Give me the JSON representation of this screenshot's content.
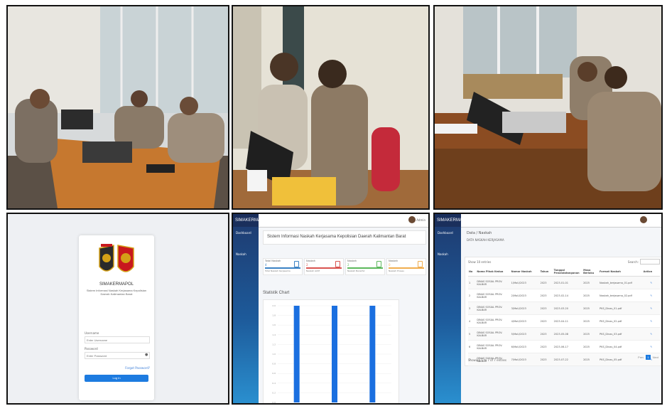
{
  "photos": [
    {
      "label": "meeting-photo-1"
    },
    {
      "label": "meeting-photo-2"
    },
    {
      "label": "meeting-photo-3"
    }
  ],
  "login": {
    "app_name": "SIMAKERMAPOL",
    "subtitle": "Sistem Informasi Naskah Kerjasama Kepolisian Daerah Kalimantan Barat",
    "username_label": "Username",
    "username_placeholder": "Enter Username",
    "password_label": "Password",
    "password_placeholder": "Enter Password",
    "forgot": "Forgot Password?",
    "login_button": "Log In"
  },
  "dashboard": {
    "brand": "SIMAKERMAPOL",
    "nav": [
      "Dashboard",
      "Naskah"
    ],
    "heading": "Sistem Informasi Naskah Kerjasama Kepolisian Daerah Kalimantan Barat",
    "cards": [
      {
        "title": "Total Naskah",
        "value": "4",
        "foot": "Total Naskah Kerjasama",
        "color": "#3b82c4"
      },
      {
        "title": "Naskah",
        "value": "2",
        "foot": "Naskah Aktif",
        "color": "#d9534f"
      },
      {
        "title": "Naskah",
        "value": "2",
        "foot": "Naskah Berakhir",
        "color": "#5cb85c"
      },
      {
        "title": "Naskah",
        "value": "0",
        "foot": "Naskah Proses",
        "color": "#f0ad4e"
      }
    ],
    "chart_title": "Statistik Chart",
    "user": "Admin"
  },
  "chart_data": {
    "type": "bar",
    "title": "Statistik Chart",
    "categories": [
      "",
      "",
      ""
    ],
    "values": [
      2.0,
      2.0,
      2.0
    ],
    "ylim": [
      0,
      2.0
    ],
    "color": "#1a6fe0"
  },
  "table_page": {
    "brand": "SIMAKERMAPOL",
    "nav": [
      "Dashboard",
      "Naskah"
    ],
    "breadcrumb": "Data  /  Naskah",
    "subtitle": "DATA NASKAH KERJASAMA",
    "show_label": "Show  10  entries",
    "search_label": "Search:",
    "columns": [
      "No",
      "Nama Pihak Kedua",
      "Nomor Naskah",
      "Tahun",
      "Tanggal Penandatanganan",
      "Masa Berlaku",
      "Format Naskah",
      "Action"
    ],
    "rows": [
      [
        "1",
        "DINAS SOSIAL PROV. KALBAR",
        "1/MoU/2023",
        "2023",
        "2023-01-01",
        "2025",
        "Naskah_kerjasama_01.pdf",
        "✎"
      ],
      [
        "2",
        "DINAS SOSIAL PROV. KALBAR",
        "2/MoU/2023",
        "2023",
        "2023-02-14",
        "2025",
        "Naskah_kerjasama_02.pdf",
        "✎"
      ],
      [
        "3",
        "DINAS SOSIAL PROV. KALBAR",
        "3/MoU/2023",
        "2023",
        "2023-03-20",
        "2025",
        "PKS_Dinas_01.pdf",
        "✎"
      ],
      [
        "4",
        "DINAS SOSIAL PROV. KALBAR",
        "4/MoU/2023",
        "2023",
        "2023-04-11",
        "2025",
        "PKS_Dinas_02.pdf",
        "✎"
      ],
      [
        "5",
        "DINAS SOSIAL PROV. KALBAR",
        "5/MoU/2023",
        "2023",
        "2023-05-08",
        "2025",
        "PKS_Dinas_03.pdf",
        "✎"
      ],
      [
        "6",
        "DINAS SOSIAL PROV. KALBAR",
        "6/MoU/2023",
        "2023",
        "2023-06-17",
        "2025",
        "PKS_Dinas_04.pdf",
        "✎"
      ],
      [
        "7",
        "DINAS SOSIAL PROV. KALBAR",
        "7/MoU/2023",
        "2023",
        "2023-07-22",
        "2025",
        "PKS_Dinas_05.pdf",
        "✎"
      ]
    ],
    "footer": "Showing 1 to 7 of 7 entries",
    "pager_prev": "Prev",
    "pager_cur": "1",
    "pager_next": "Next"
  }
}
